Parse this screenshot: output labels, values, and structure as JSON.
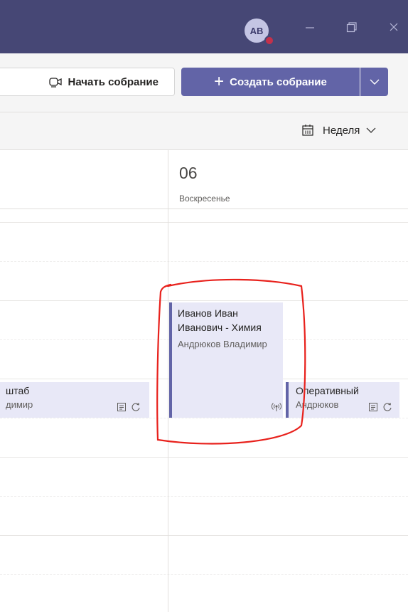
{
  "titlebar": {
    "avatar_initials": "AB",
    "minimize_icon": "minimize-icon",
    "restore_icon": "restore-icon",
    "close_icon": "close-icon"
  },
  "toolbar": {
    "start_meeting_label": "Начать собрание",
    "create_meeting_label": "Создать собрание",
    "accent_color": "#6264a7"
  },
  "viewbar": {
    "view_label": "Неделя"
  },
  "day": {
    "number": "06",
    "name": "Воскресенье"
  },
  "events": {
    "left": {
      "title": "штаб",
      "organizer": "димир"
    },
    "main": {
      "title": "Иванов Иван Иванович - Химия",
      "organizer": "Андрюков Владимир"
    },
    "right": {
      "title": "Оперативный",
      "organizer": "Андрюков"
    }
  }
}
